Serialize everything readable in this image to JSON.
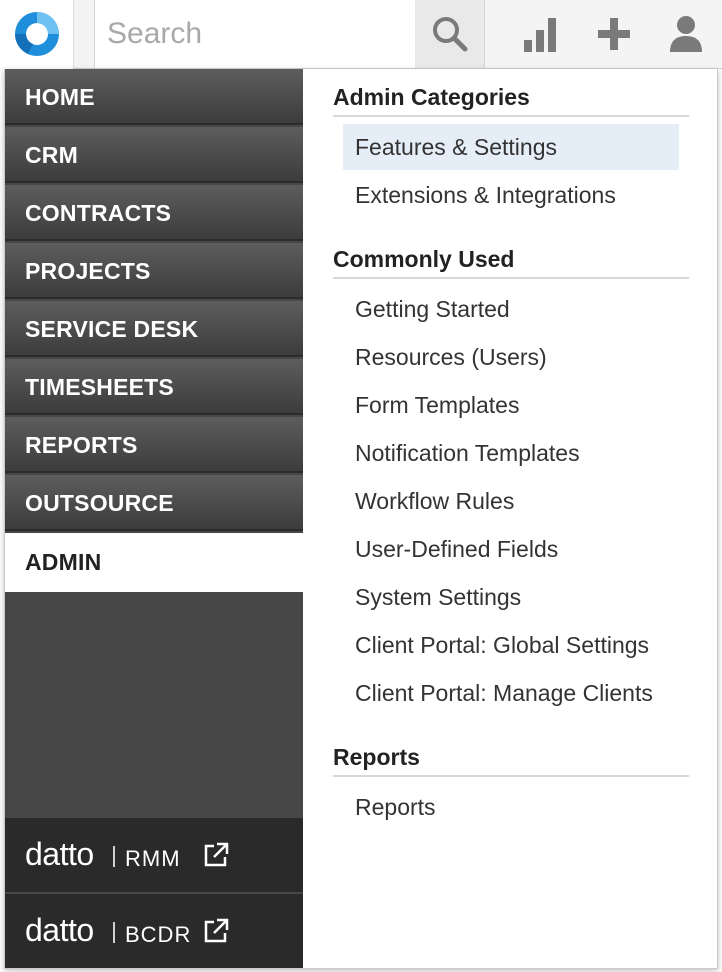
{
  "search": {
    "placeholder": "Search"
  },
  "nav": {
    "items": [
      {
        "label": "HOME"
      },
      {
        "label": "CRM"
      },
      {
        "label": "CONTRACTS"
      },
      {
        "label": "PROJECTS"
      },
      {
        "label": "SERVICE DESK"
      },
      {
        "label": "TIMESHEETS"
      },
      {
        "label": "REPORTS"
      },
      {
        "label": "OUTSOURCE"
      },
      {
        "label": "ADMIN",
        "active": true
      }
    ],
    "external": [
      {
        "brand": "datto",
        "product": "RMM"
      },
      {
        "brand": "datto",
        "product": "BCDR"
      }
    ]
  },
  "admin_categories": {
    "title": "Admin Categories",
    "items": [
      "Features & Settings",
      "Extensions & Integrations"
    ],
    "highlighted": "Features & Settings"
  },
  "commonly_used": {
    "title": "Commonly Used",
    "items": [
      "Getting Started",
      "Resources (Users)",
      "Form Templates",
      "Notification Templates",
      "Workflow Rules",
      "User-Defined Fields",
      "System Settings",
      "Client Portal: Global Settings",
      "Client Portal: Manage Clients"
    ]
  },
  "reports": {
    "title": "Reports",
    "items": [
      "Reports"
    ]
  },
  "colors": {
    "logo_blue": "#1f8fdc",
    "nav_bg": "#474747",
    "highlight": "#e5edf6"
  },
  "icons": {
    "logo": "autotask-logo-icon",
    "search": "search-icon",
    "chart": "bar-chart-icon",
    "add": "plus-icon",
    "user": "user-icon",
    "external": "external-link-icon"
  }
}
